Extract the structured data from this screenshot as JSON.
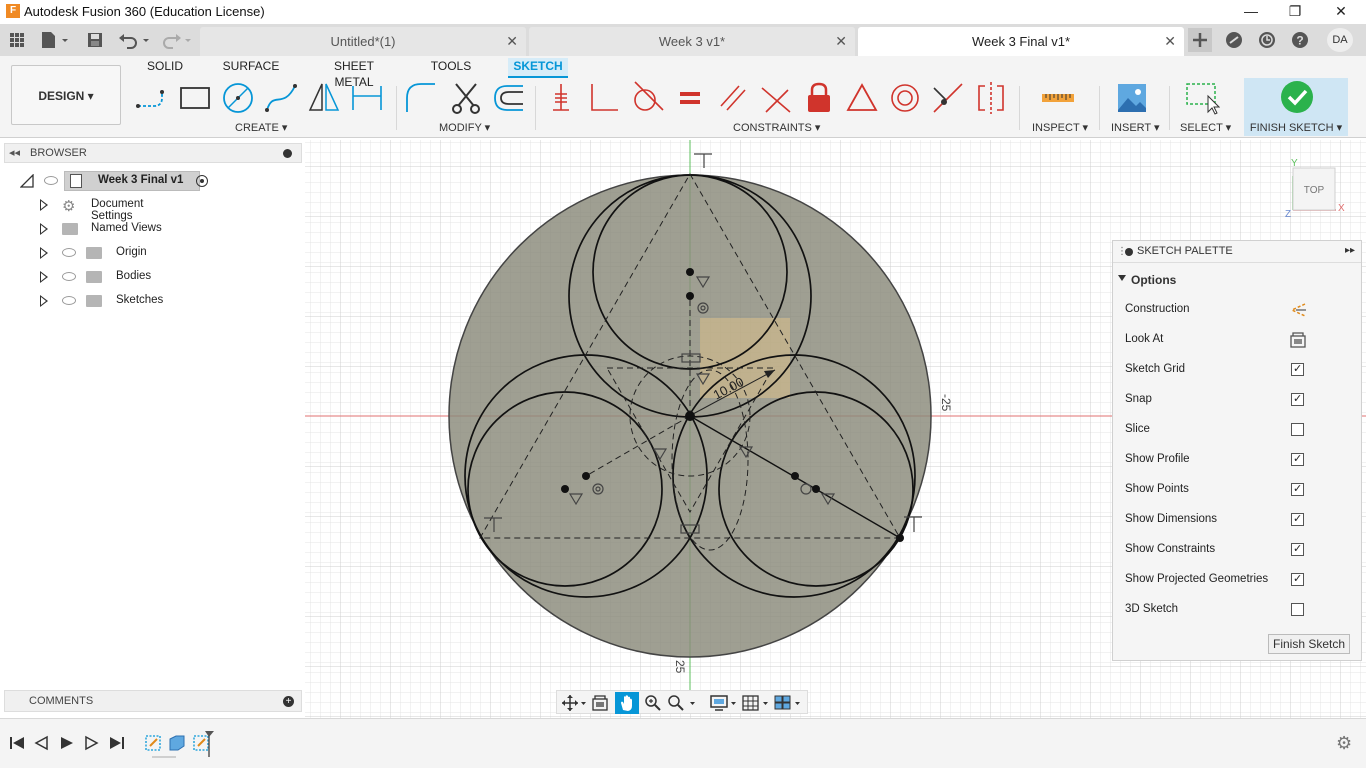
{
  "window": {
    "title": "Autodesk Fusion 360 (Education License)",
    "app_icon": "F",
    "minimize": "—",
    "maximize": "❐",
    "close": "✕"
  },
  "doc_tabs": [
    {
      "label": "Untitled*(1)",
      "active": false
    },
    {
      "label": "Week 3 v1*",
      "active": false
    },
    {
      "label": "Week 3 Final v1*",
      "active": true
    }
  ],
  "user": {
    "initials": "DA"
  },
  "ribbon": {
    "workspace": "DESIGN ▾",
    "tabs": [
      "SOLID",
      "SURFACE",
      "SHEET METAL",
      "TOOLS",
      "SKETCH"
    ],
    "active_tab": "SKETCH",
    "groups": {
      "create": "CREATE ▾",
      "modify": "MODIFY ▾",
      "constraints": "CONSTRAINTS ▾",
      "inspect": "INSPECT ▾",
      "insert": "INSERT ▾",
      "select": "SELECT ▾",
      "finish": "FINISH SKETCH ▾"
    }
  },
  "browser": {
    "header": "BROWSER",
    "root": "Week 3 Final v1",
    "items": [
      "Document Settings",
      "Named Views",
      "Origin",
      "Bodies",
      "Sketches"
    ]
  },
  "canvas": {
    "dimension_label": "10.00",
    "axis_label_right": "-25",
    "axis_label_bottom": "25",
    "viewcube_label": "TOP",
    "axis_x": "X",
    "axis_y": "Y",
    "axis_z": "Z"
  },
  "palette": {
    "title": "SKETCH PALETTE",
    "section": "Options",
    "rows": [
      {
        "label": "Construction",
        "kind": "icon"
      },
      {
        "label": "Look At",
        "kind": "icon"
      },
      {
        "label": "Sketch Grid",
        "checked": true
      },
      {
        "label": "Snap",
        "checked": true
      },
      {
        "label": "Slice",
        "checked": false
      },
      {
        "label": "Show Profile",
        "checked": true
      },
      {
        "label": "Show Points",
        "checked": true
      },
      {
        "label": "Show Dimensions",
        "checked": true
      },
      {
        "label": "Show Constraints",
        "checked": true
      },
      {
        "label": "Show Projected Geometries",
        "checked": true
      },
      {
        "label": "3D Sketch",
        "checked": false
      }
    ],
    "finish_button": "Finish Sketch"
  },
  "comments": {
    "label": "COMMENTS"
  },
  "colors": {
    "accent": "#0696d7",
    "finish_green": "#2bb24c",
    "sketch_fill": "#8a8a7a",
    "profile_highlight": "#e8c88a"
  }
}
